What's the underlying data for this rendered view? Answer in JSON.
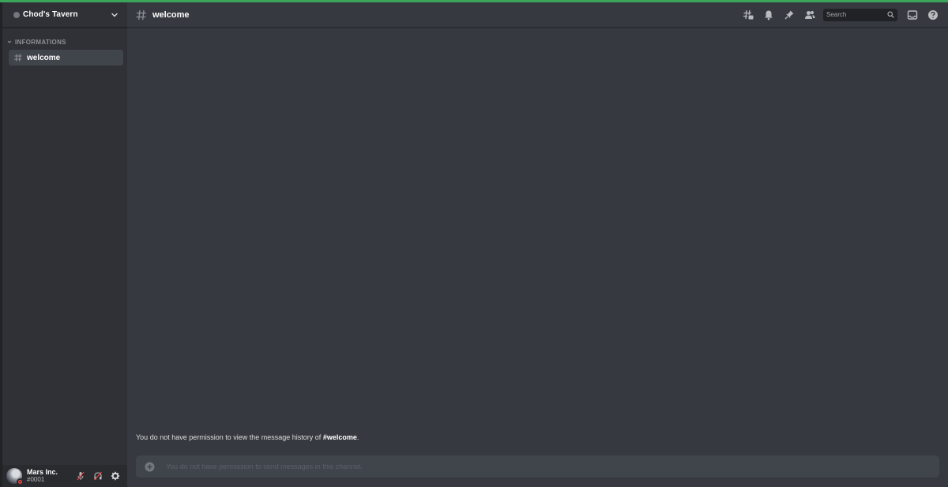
{
  "colors": {
    "accent_bar": "#3ba55c",
    "sidebar_bg": "#2f3136",
    "main_bg": "#36393f",
    "status_dnd": "#ed4245",
    "muted_icon": "#b9bbbe"
  },
  "server": {
    "name": "Chod's Tavern",
    "menu_icon": "chevron-down-icon"
  },
  "sidebar": {
    "category": "INFORMATIONS",
    "channels": [
      {
        "label": "welcome",
        "icon": "hash-icon",
        "selected": true
      }
    ]
  },
  "user": {
    "name": "Mars Inc.",
    "tag": "#0001",
    "status": "do-not-disturb",
    "controls": [
      "mic-muted-icon",
      "headphones-deafened-icon",
      "gear-icon"
    ]
  },
  "header": {
    "channel": "welcome",
    "icons": [
      "threads-icon",
      "bell-icon",
      "pin-icon",
      "members-icon",
      "inbox-icon",
      "help-icon"
    ],
    "search_placeholder": "Search"
  },
  "main": {
    "history_notice_prefix": "You do not have permission to view the message history of ",
    "history_notice_channel": "#welcome",
    "history_notice_suffix": ".",
    "composer_placeholder": "You do not have permission to send messages in this channel."
  }
}
